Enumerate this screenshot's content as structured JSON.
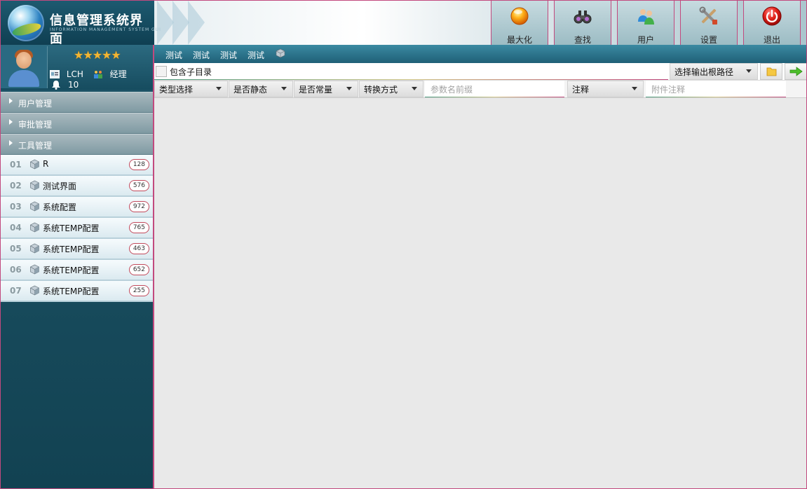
{
  "app": {
    "title": "信息管理系统界面",
    "subtitle": "INFORMATION MANAGEMENT SYSTEM GUI"
  },
  "toolbar": [
    {
      "label": "最大化",
      "icon": "orange-orb-icon"
    },
    {
      "label": "查找",
      "icon": "binoculars-icon"
    },
    {
      "label": "用户",
      "icon": "users-icon"
    },
    {
      "label": "设置",
      "icon": "tools-icon"
    },
    {
      "label": "退出",
      "icon": "power-icon"
    }
  ],
  "user": {
    "stars": "★★★★★",
    "name": "LCH",
    "role": "经理",
    "notifications": "10"
  },
  "nav": {
    "sections": [
      "用户管理",
      "审批管理",
      "工具管理"
    ],
    "items": [
      {
        "num": "01",
        "name": "R",
        "count": "128"
      },
      {
        "num": "02",
        "name": "测试界面",
        "count": "576"
      },
      {
        "num": "03",
        "name": "系统配置",
        "count": "972"
      },
      {
        "num": "04",
        "name": "系统TEMP配置",
        "count": "765"
      },
      {
        "num": "05",
        "name": "系统TEMP配置",
        "count": "463"
      },
      {
        "num": "06",
        "name": "系统TEMP配置",
        "count": "652"
      },
      {
        "num": "07",
        "name": "系统TEMP配置",
        "count": "255"
      }
    ]
  },
  "tabs": [
    "测试",
    "测试",
    "测试",
    "测试"
  ],
  "form": {
    "include_subdir_label": "包含子目录",
    "output_root_select": "选择输出根路径",
    "type_select": "类型选择",
    "is_static_select": "是否静态",
    "is_const_select": "是否常量",
    "convert_select": "转换方式",
    "param_prefix_placeholder": "参数名前缀",
    "comment_select": "注释",
    "attach_comment_placeholder": "附件注释"
  },
  "colors": {
    "accent_border": "#c2497e",
    "sidebar_dark": "#124252",
    "tabbar": "#2a7189"
  }
}
